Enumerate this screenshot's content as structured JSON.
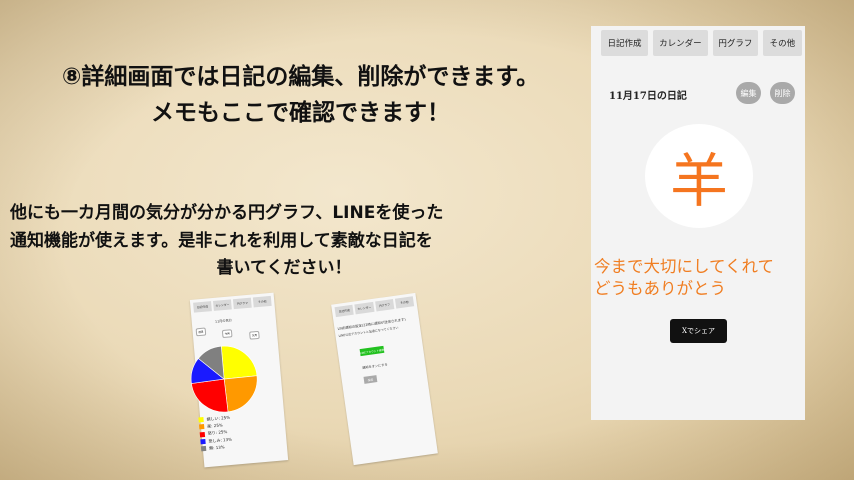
{
  "headline": {
    "line1": "⑧詳細画面では日記の編集、削除ができます。",
    "line2": "メモもここで確認できます！"
  },
  "subtext": {
    "line1": "他にも一カ月間の気分が分かる円グラフ、LINEを使った",
    "line2": "通知機能が使えます。是非これを利用して素敵な日記を",
    "line3": "書いてください！"
  },
  "phone": {
    "tabs": [
      "日記作成",
      "カレンダー",
      "円グラフ",
      "その他"
    ],
    "diary_title": "11月17日の日記",
    "edit_label": "編集",
    "delete_label": "削除",
    "kanji": "羊",
    "memo_line1": "今まで大切にしてくれて",
    "memo_line2": "どうもありがとう",
    "share_label": "Xでシェア",
    "accent_color": "#f5751f"
  },
  "mini_pie": {
    "tabs": [
      "日記作成",
      "カレンダー",
      "円グラフ",
      "その他"
    ],
    "title": "11月の気分",
    "buttons": [
      "前月",
      "今月",
      "次月"
    ],
    "legend": [
      {
        "label": "嬉しい: 25%",
        "color": "#ffff00"
      },
      {
        "label": "楽: 25%",
        "color": "#ff9900"
      },
      {
        "label": "怒り: 25%",
        "color": "#ff0000"
      },
      {
        "label": "悲しみ: 13%",
        "color": "#1a1aff"
      },
      {
        "label": "無: 13%",
        "color": "#808080"
      }
    ]
  },
  "mini_line": {
    "tabs": [
      "日記作成",
      "カレンダー",
      "円グラフ",
      "その他"
    ],
    "notice1": "LINE通知の設定(22時に通知が送信されます)",
    "notice2": "LINE公式アカウントと友達になってください",
    "green_button": "LINEアカウント連携",
    "toggle_text": "通知をオンにする",
    "save_button": "保存"
  }
}
